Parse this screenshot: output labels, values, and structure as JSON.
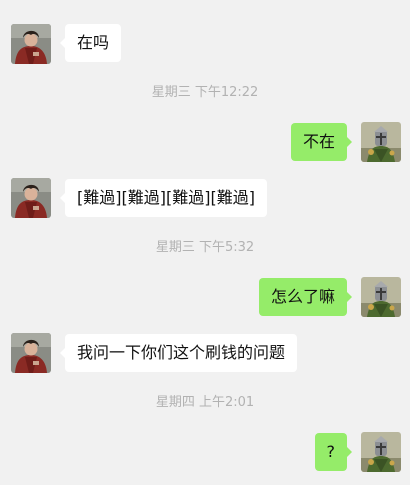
{
  "messages": [
    {
      "side": "left",
      "sender_avatar": "user-avatar-photo",
      "text": "在吗"
    },
    {
      "side": "time",
      "text": "星期三 下午12:22"
    },
    {
      "side": "right",
      "sender_avatar": "knight-avatar-photo",
      "text": "不在"
    },
    {
      "side": "left",
      "sender_avatar": "user-avatar-photo",
      "text": "[難過][難過][難過][難過]"
    },
    {
      "side": "time",
      "text": "星期三 下午5:32"
    },
    {
      "side": "right",
      "sender_avatar": "knight-avatar-photo",
      "text": "怎么了嘛"
    },
    {
      "side": "left",
      "sender_avatar": "user-avatar-photo",
      "text": "我问一下你们这个刷钱的问题"
    },
    {
      "side": "time",
      "text": "星期四 上午2:01"
    },
    {
      "side": "right",
      "sender_avatar": "knight-avatar-photo",
      "text": "?"
    }
  ],
  "colors": {
    "background": "#f1f1f1",
    "incoming_bubble": "#ffffff",
    "outgoing_bubble": "#95ec69",
    "timestamp_text": "#b2b2b2"
  }
}
